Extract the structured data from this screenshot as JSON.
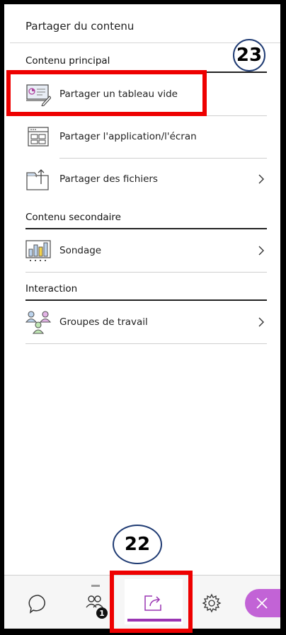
{
  "panel": {
    "title": "Partager du contenu"
  },
  "sections": {
    "main": {
      "header": "Contenu principal",
      "items": [
        {
          "label": "Partager un tableau vide",
          "icon": "whiteboard-icon"
        },
        {
          "label": "Partager l'application/l'écran",
          "icon": "app-screen-icon"
        },
        {
          "label": "Partager des fichiers",
          "icon": "folder-upload-icon"
        }
      ]
    },
    "secondary": {
      "header": "Contenu secondaire",
      "items": [
        {
          "label": "Sondage",
          "icon": "poll-chart-icon"
        }
      ]
    },
    "interaction": {
      "header": "Interaction",
      "items": [
        {
          "label": "Groupes de travail",
          "icon": "breakout-groups-icon"
        }
      ]
    }
  },
  "annotations": {
    "badge_23": "23",
    "badge_22": "22"
  },
  "bottom_bar": {
    "tabs": [
      {
        "icon": "chat-icon"
      },
      {
        "icon": "participants-icon",
        "count": "1"
      },
      {
        "icon": "share-content-icon",
        "active": true
      },
      {
        "icon": "gear-icon"
      },
      {
        "icon": "close-icon"
      }
    ]
  },
  "colors": {
    "accent": "#9a35b3",
    "close_button": "#c263d6",
    "annotation_red": "#ee0000",
    "annotation_circle": "#1f3b73"
  }
}
